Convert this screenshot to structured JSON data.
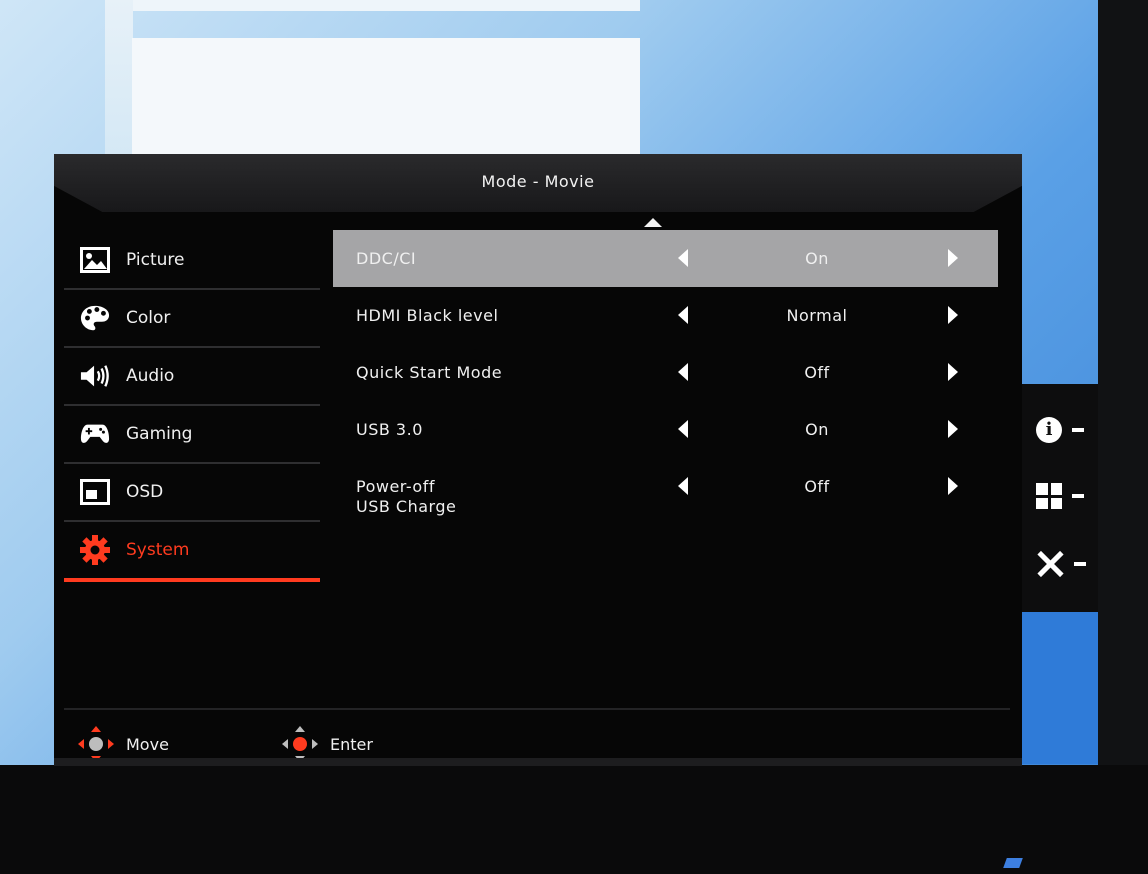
{
  "osd": {
    "title": "Mode - Movie",
    "accent_color": "#ff3b1f",
    "sidebar": [
      {
        "label": "Picture",
        "icon": "picture-icon",
        "active": false
      },
      {
        "label": "Color",
        "icon": "palette-icon",
        "active": false
      },
      {
        "label": "Audio",
        "icon": "speaker-icon",
        "active": false
      },
      {
        "label": "Gaming",
        "icon": "gamepad-icon",
        "active": false
      },
      {
        "label": "OSD",
        "icon": "osd-window-icon",
        "active": false
      },
      {
        "label": "System",
        "icon": "gear-icon",
        "active": true
      }
    ],
    "settings": [
      {
        "label": "DDC/CI",
        "value": "On",
        "selected": true
      },
      {
        "label": "HDMI Black level",
        "value": "Normal",
        "selected": false
      },
      {
        "label": "Quick Start Mode",
        "value": "Off",
        "selected": false
      },
      {
        "label": "USB 3.0",
        "value": "On",
        "selected": false
      },
      {
        "label_line1": "Power-off",
        "label_line2": "USB Charge",
        "value": "Off",
        "selected": false
      }
    ],
    "footer": {
      "move_label": "Move",
      "enter_label": "Enter"
    }
  },
  "side_keys": [
    {
      "icon": "info-icon"
    },
    {
      "icon": "grid-icon"
    },
    {
      "icon": "close-icon"
    }
  ]
}
